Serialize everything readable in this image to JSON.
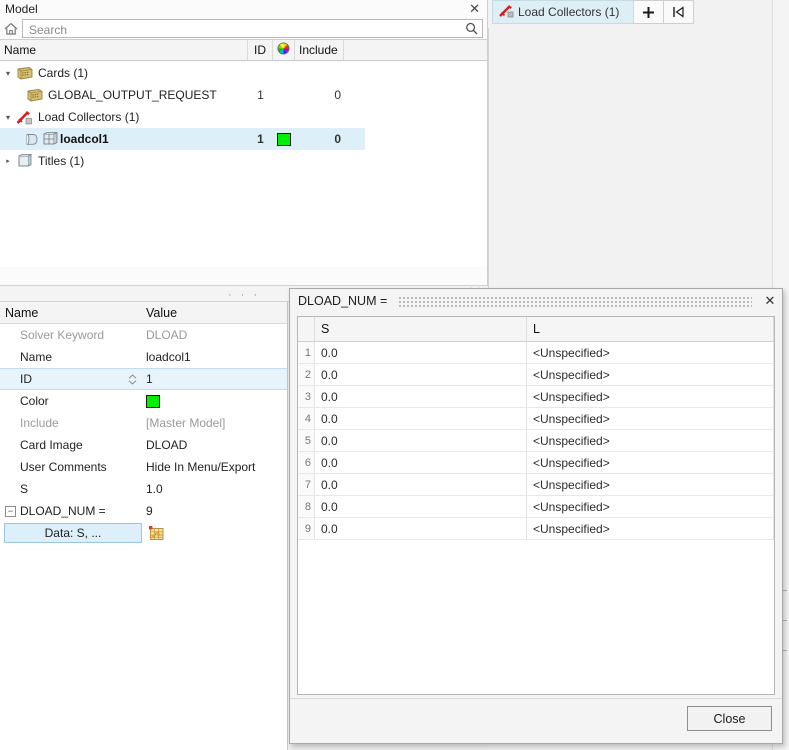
{
  "toolbar": {
    "entity_label": "Load Collectors (1)",
    "entity_icon": "load-collector-icon",
    "caret_icon": "chevron-down-icon",
    "add_label": "+",
    "collapse_label": "I◀"
  },
  "model_panel": {
    "title": "Model",
    "close_label": "✕",
    "home_icon": "home-icon",
    "search": {
      "value": "",
      "placeholder": "Search",
      "icon": "search-icon"
    },
    "columns": [
      {
        "label": "Name"
      },
      {
        "label": "ID"
      },
      {
        "label": "",
        "icon": "color-wheel-icon"
      },
      {
        "label": "Include"
      },
      {
        "label": ""
      }
    ],
    "rows": [
      {
        "twisty": "▾",
        "icon": "card-icon",
        "label": "Cards (1)",
        "id": "",
        "include": "",
        "indent": 0,
        "selected": false,
        "color": ""
      },
      {
        "twisty": "",
        "icon": "card-icon",
        "label": "GLOBAL_OUTPUT_REQUEST",
        "id": "1",
        "include": "0",
        "indent": 1,
        "selected": false,
        "color": ""
      },
      {
        "twisty": "▾",
        "icon": "load-collector-icon",
        "label": "Load Collectors (1)",
        "id": "",
        "include": "",
        "indent": 0,
        "selected": false,
        "color": ""
      },
      {
        "twisty": "",
        "icon": "loadcol-icon",
        "label": "loadcol1",
        "id": "1",
        "include": "0",
        "indent": 1,
        "selected": true,
        "color": "#00EE00"
      },
      {
        "twisty": "▸",
        "icon": "titles-icon",
        "label": "Titles (1)",
        "id": "",
        "include": "",
        "indent": 0,
        "selected": false,
        "color": ""
      }
    ]
  },
  "splitter": {
    "grip_label": "· · ·",
    "chevron_label": "ˇˇ"
  },
  "properties": {
    "header": {
      "name": "Name",
      "value": "Value"
    },
    "rows": [
      {
        "name": "Solver Keyword",
        "value": "DLOAD",
        "dim": true,
        "kind": "text"
      },
      {
        "name": "Name",
        "value": "loadcol1",
        "dim": false,
        "kind": "text"
      },
      {
        "name": "ID",
        "value": "1",
        "dim": false,
        "kind": "spinner",
        "highlight": true
      },
      {
        "name": "Color",
        "value": "",
        "dim": false,
        "kind": "color",
        "color": "#00EE00"
      },
      {
        "name": "Include",
        "value": "[Master Model]",
        "dim": true,
        "kind": "text"
      },
      {
        "name": "Card Image",
        "value": "DLOAD",
        "dim": false,
        "kind": "text"
      },
      {
        "name": "User Comments",
        "value": "Hide In Menu/Export",
        "dim": false,
        "kind": "text"
      },
      {
        "name": "S",
        "value": "1.0",
        "dim": false,
        "kind": "text"
      },
      {
        "name": "DLOAD_NUM =",
        "value": "9",
        "dim": false,
        "kind": "group",
        "expander": "−"
      }
    ],
    "data_button": {
      "label": "Data: S, ...",
      "icon": "table-grid-icon"
    }
  },
  "dialog": {
    "title": "DLOAD_NUM =",
    "close_label": "✕",
    "grip_icon": "dotted-grip",
    "table": {
      "columns": [
        "",
        "S",
        "L"
      ],
      "rows": [
        {
          "n": "1",
          "S": "0.0",
          "L": "<Unspecified>"
        },
        {
          "n": "2",
          "S": "0.0",
          "L": "<Unspecified>"
        },
        {
          "n": "3",
          "S": "0.0",
          "L": "<Unspecified>"
        },
        {
          "n": "4",
          "S": "0.0",
          "L": "<Unspecified>"
        },
        {
          "n": "5",
          "S": "0.0",
          "L": "<Unspecified>"
        },
        {
          "n": "6",
          "S": "0.0",
          "L": "<Unspecified>"
        },
        {
          "n": "7",
          "S": "0.0",
          "L": "<Unspecified>"
        },
        {
          "n": "8",
          "S": "0.0",
          "L": "<Unspecified>"
        },
        {
          "n": "9",
          "S": "0.0",
          "L": "<Unspecified>"
        }
      ]
    },
    "close_button": "Close"
  },
  "colors": {
    "selection_blue": "#ddf0f9",
    "toolbar_entity_bg": "#ddeef4",
    "loadcol_green": "#00EE00",
    "panel_bg": "#f2f2f2"
  }
}
